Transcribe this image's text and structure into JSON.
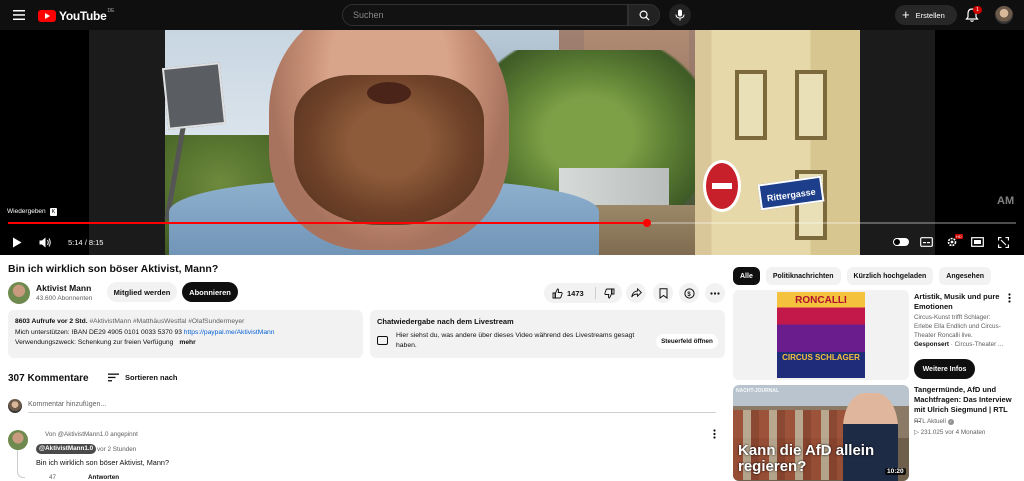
{
  "masthead": {
    "logo_text": "YouTube",
    "country": "DE",
    "search_placeholder": "Suchen",
    "create_label": "Erstellen",
    "notification_count": "1"
  },
  "player": {
    "tooltip": "Wiedergeben",
    "tooltip_key": "K",
    "current_time": "5:14",
    "duration": "8:15",
    "progress_fraction": 0.634,
    "street_sign": "Rittergasse",
    "watermark": "AM"
  },
  "video": {
    "title": "Bin ich wirklich son böser Aktivist, Mann?",
    "channel_name": "Aktivist Mann",
    "subscribers": "43.600 Abonnenten",
    "member_label": "Mitglied werden",
    "subscribe_label": "Abonnieren",
    "likes": "1473"
  },
  "description": {
    "meta": "8603 Aufrufe  vor 2 Std.",
    "tags": "#AktivistMann #MatthäusWestfal #OlafSundermeyer",
    "line2_prefix": "Mich unterstützen: IBAN DE29 4905 0101 0033 5370 93 ",
    "link": "https://paypal.me/AktivistMann",
    "line3": "Verwendungszweck: Schenkung zur freien Verfügung",
    "more": "mehr"
  },
  "chat": {
    "title": "Chatwiedergabe nach dem Livestream",
    "text": "Hier siehst du, was andere über dieses Video während des Livestreams gesagt haben.",
    "button": "Steuerfeld öffnen"
  },
  "comments": {
    "count_label": "307 Kommentare",
    "sort_label": "Sortieren nach",
    "add_placeholder": "Kommentar hinzufügen...",
    "pinned": "Von @AktivistMann1.0 angepinnt",
    "author": "@AktivistMann1.0",
    "time": "vor 2 Stunden",
    "text": "Bin ich wirklich son böser Aktivist, Mann?",
    "likes": "47",
    "reply": "Antworten"
  },
  "sidebar": {
    "chips": [
      "Alle",
      "Politiknachrichten",
      "Kürzlich hochgeladen",
      "Angesehen"
    ],
    "ad": {
      "poster_title": "RONCALLI",
      "poster_sub": "CIRCUS SCHLAGER",
      "title": "Artistik, Musik und pure Emotionen",
      "description": "Circus-Kunst trifft Schlager: Erlebe Ella Endlich und Circus-Theater Roncalli live.",
      "sponsor_label": "Gesponsert",
      "sponsor_name": " · Circus-Theater ...",
      "cta": "Weitere Infos"
    },
    "video": {
      "thumb_label": "NACHT-JOURNAL",
      "thumb_text": "Kann die AfD allein regieren?",
      "duration": "10:20",
      "title": "Tangermünde, AfD und Machtfragen: Das Interview mit Ulrich Siegmund | RTL ...",
      "channel": "RTL Aktuell",
      "meta": "▷ 231.025   vor 4 Monaten"
    }
  },
  "colors": {
    "brand_red": "#ff0000",
    "masthead_bg": "#0f0f0f",
    "link_blue": "#065fd4"
  }
}
